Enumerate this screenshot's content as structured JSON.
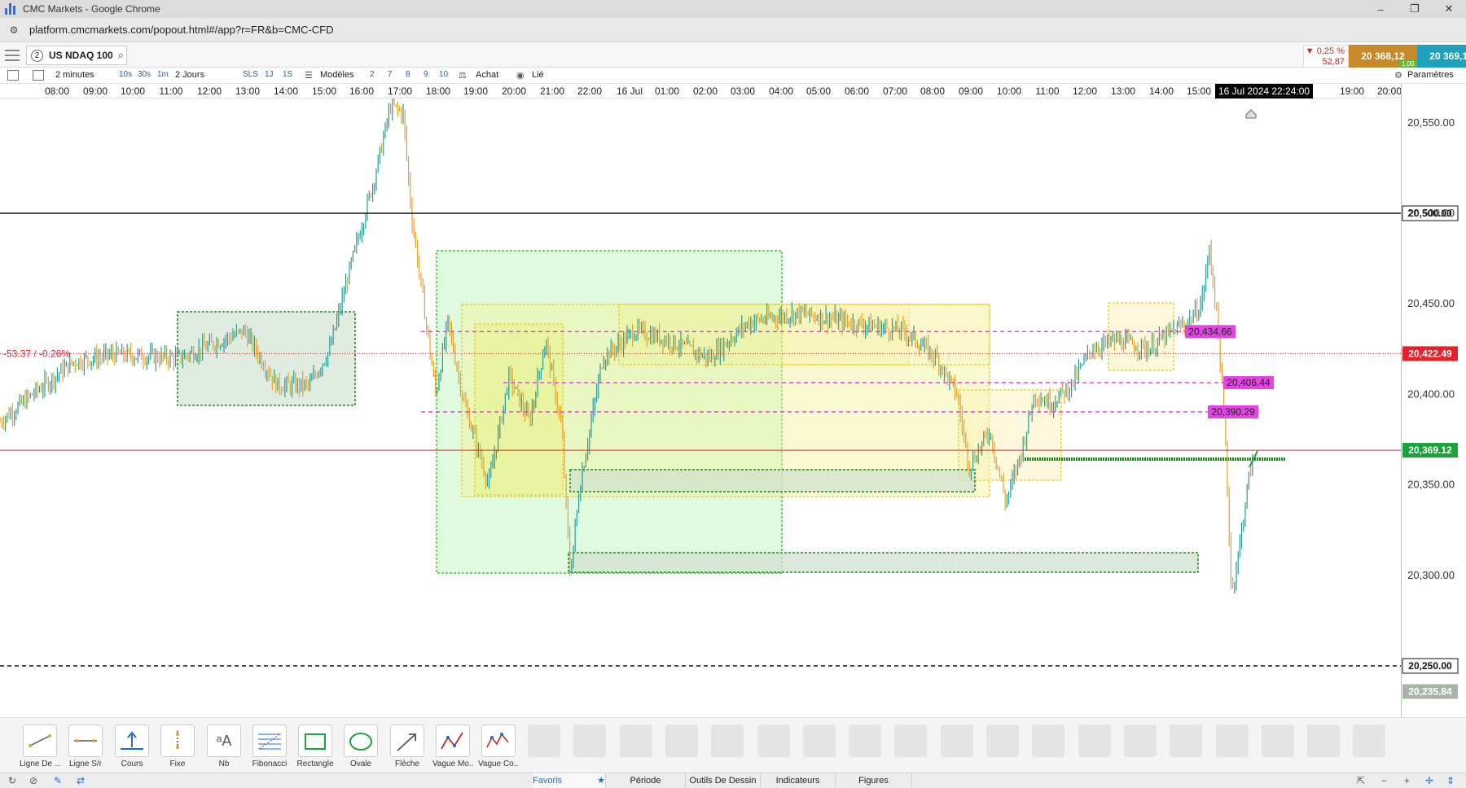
{
  "window": {
    "title": "CMC Markets - Google Chrome",
    "controls": {
      "minimize": "–",
      "restore": "❐",
      "close": "✕"
    }
  },
  "browser": {
    "url": "platform.cmcmarkets.com/popout.html#/app?r=FR&b=CMC-CFD"
  },
  "instrument": {
    "badge": "2",
    "name": "US NDAQ 100",
    "change_pct": "▼ 0,25 %",
    "change_abs": "52,87",
    "sell_price": "20 368,12",
    "buy_price": "20 369,12",
    "spread": "1,00",
    "sell_color": "#c68a2a",
    "buy_color": "#1fa1bc"
  },
  "toolbar": {
    "interval": "2 minutes",
    "quick_intervals": [
      "10s",
      "30s",
      "1m"
    ],
    "range": "2 Jours",
    "quick_ranges": [
      "SLS",
      "1J",
      "1S"
    ],
    "templates": "Modèles",
    "numbers": [
      "2",
      "7",
      "8",
      "9",
      "10"
    ],
    "buy": "Achat",
    "linked": "Lié",
    "settings": "Paramètres"
  },
  "time_axis": {
    "labels": [
      "08:00",
      "09:00",
      "10:00",
      "11:00",
      "12:00",
      "13:00",
      "14:00",
      "15:00",
      "16:00",
      "17:00",
      "18:00",
      "19:00",
      "20:00",
      "21:00",
      "22:00",
      "16 Jul",
      "01:00",
      "02:00",
      "03:00",
      "04:00",
      "05:00",
      "06:00",
      "07:00",
      "08:00",
      "09:00",
      "10:00",
      "11:00",
      "12:00",
      "13:00",
      "14:00",
      "15:00",
      "19:00",
      "20:00"
    ],
    "crosshair": "16 Jul 2024 22:24:00"
  },
  "chart_data": {
    "type": "candlestick",
    "ylim": [
      20230,
      20580
    ],
    "y_ticks": [
      "20,550.00",
      "20,500.00",
      "20,450.00",
      "20,400.00",
      "20,350.00",
      "20,300.00"
    ],
    "y_tick_values": [
      20550,
      20500,
      20450,
      20400,
      20350,
      20300
    ],
    "price_tags": [
      {
        "label": "20,500.00",
        "value": 20500,
        "style": "outline"
      },
      {
        "label": "20,422.49",
        "value": 20422.49,
        "color": "#e8202a"
      },
      {
        "label": "20,369.12",
        "value": 20369.12,
        "color": "#1aa33a"
      },
      {
        "label": "20,250.00",
        "value": 20250,
        "style": "outline"
      },
      {
        "label": "20,235.84",
        "value": 20235.84,
        "color": "#a9b4a9"
      }
    ],
    "line_labels": [
      {
        "label": "20,434.66",
        "value": 20434.66
      },
      {
        "label": "20,406.44",
        "value": 20406.44
      },
      {
        "label": "20,390.29",
        "value": 20390.29
      }
    ],
    "prev_close_label": "-53.37 / -0.26%",
    "label_color": "#e246e2",
    "colors": {
      "up": "#2a9a95",
      "down": "#e8a12a"
    }
  },
  "drawing_tools": [
    {
      "label": "Ligne De ...",
      "icon": "trend-line-icon"
    },
    {
      "label": "Ligne S/r",
      "icon": "sr-line-icon"
    },
    {
      "label": "Cours",
      "icon": "price-icon"
    },
    {
      "label": "Fixe",
      "icon": "fixed-icon"
    },
    {
      "label": "Nb",
      "icon": "text-icon",
      "glyph": "ᵃA"
    },
    {
      "label": "Fibonacci",
      "icon": "fibonacci-icon"
    },
    {
      "label": "Rectangle",
      "icon": "rectangle-icon"
    },
    {
      "label": "Ovale",
      "icon": "oval-icon"
    },
    {
      "label": "Flèche",
      "icon": "arrow-icon"
    },
    {
      "label": "Vague Mo...",
      "icon": "wave-icon"
    },
    {
      "label": "Vague Co...",
      "icon": "wave2-icon"
    }
  ],
  "bottom_tabs": [
    "Favoris",
    "Période",
    "Outils De Dessin",
    "Indicateurs",
    "Figures"
  ]
}
